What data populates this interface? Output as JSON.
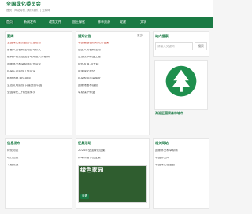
{
  "header": {
    "logo_text": "全国绿化委员会",
    "sub_text": "首页 | 网站导航 | 联系我们 | 无障碍"
  },
  "nav": {
    "items": [
      "首页",
      "新闻发布",
      "政策文件",
      "国土绿化",
      "林草资源",
      "党建",
      "文学"
    ]
  },
  "left_news": {
    "title": "要闻",
    "lines": [
      "全国绿化委员会办公室发布",
      "首都义务植树活动启动仪式",
      "植树节前后全国各地开展义务植树",
      "国家林业和草原局召开会议",
      "林草生态建设工作会议",
      "植树造林 绿化祖国",
      "生态文明建设 共建美丽中国",
      "全国绿化工作进展情况"
    ]
  },
  "mid_news": {
    "title": "通知公告",
    "more": "更多",
    "lines": [
      "中国高级植物研究所征集",
      "全国义务植树活动",
      "生态保护修复工程",
      "绿色发展 林长制",
      "城乡绿化美化",
      "林草种苗质量抽查",
      "国家储备林建设",
      "草原保护修复"
    ]
  },
  "side": {
    "search_title": "站内搜索",
    "search_placeholder": "请输入关键词",
    "search_button": "搜索",
    "emblem_caption": "海淀区国家森林城市"
  },
  "bottom_left": {
    "title": "信息发布",
    "items": [
      "绿化动态",
      "地方信息",
      "专题报道"
    ]
  },
  "bottom_mid": {
    "title": "征集活动",
    "items": [
      "2024年全国绿化征集",
      "林草科普作品征集"
    ]
  },
  "bottom_right": {
    "title": "相关网站",
    "items": [
      "国家林业和草原局",
      "中国林业网",
      "中国绿化基金会"
    ]
  },
  "poster": {
    "title": "绿色家园",
    "label": "查看"
  }
}
